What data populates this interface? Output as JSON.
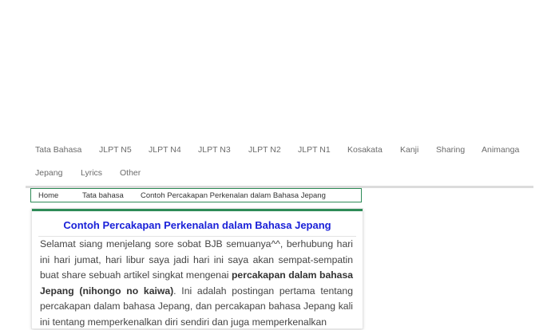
{
  "nav": {
    "items": [
      {
        "label": "Tata Bahasa"
      },
      {
        "label": "JLPT N5"
      },
      {
        "label": "JLPT N4"
      },
      {
        "label": "JLPT N3"
      },
      {
        "label": "JLPT N2"
      },
      {
        "label": "JLPT N1"
      },
      {
        "label": "Kosakata"
      },
      {
        "label": "Kanji"
      },
      {
        "label": "Sharing"
      },
      {
        "label": "Animanga"
      },
      {
        "label": "Jepang"
      },
      {
        "label": "Lyrics"
      },
      {
        "label": "Other"
      }
    ]
  },
  "breadcrumb": {
    "home": "Home",
    "category": "Tata bahasa",
    "current": "Contoh Percakapan Perkenalan dalam Bahasa Jepang"
  },
  "article": {
    "title": "Contoh Percakapan Perkenalan dalam Bahasa Jepang",
    "p1_text_a": "Selamat siang menjelang sore sobat BJB semuanya^^, berhubung hari ini hari jumat, hari libur saya jadi hari ini saya akan sempat-sempatin buat share sebuah artikel singkat mengenai ",
    "p1_bold": "percakapan dalam bahasa Jepang (nihongo no kaiwa)",
    "p1_text_b": ". Ini adalah postingan pertama tentang percakapan dalam bahasa Jepang, dan percakapan bahasa Jepang kali ini tentang memperkenalkan diri sendiri dan juga memperkenalkan"
  }
}
